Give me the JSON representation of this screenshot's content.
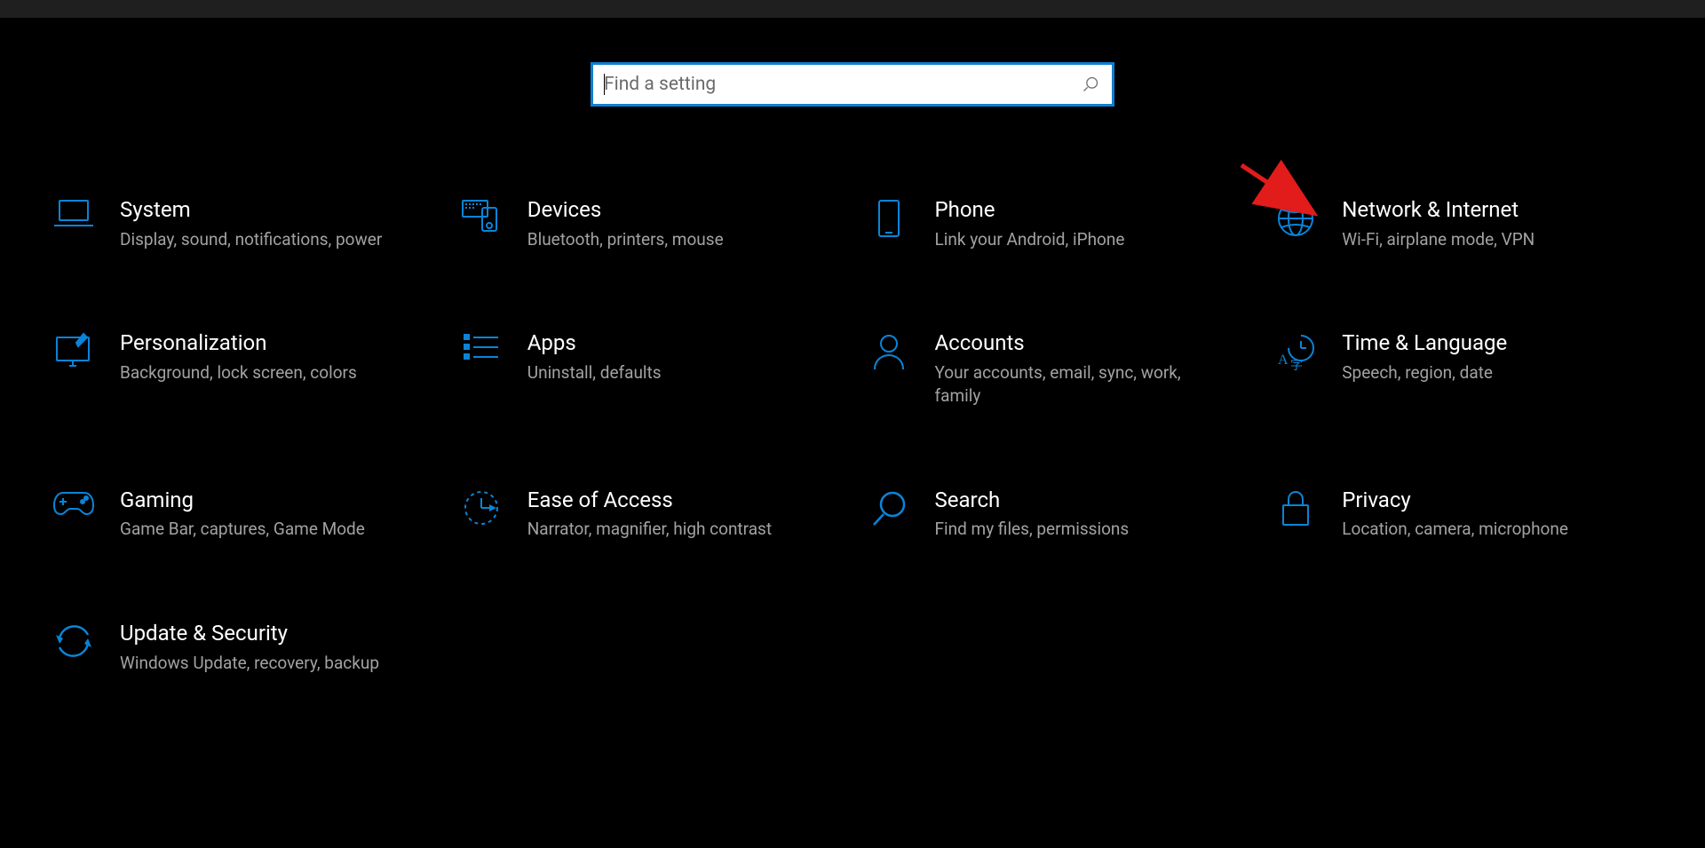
{
  "search": {
    "placeholder": "Find a setting"
  },
  "accent": "#0a84d8",
  "tiles": [
    [
      {
        "id": "system",
        "icon": "laptop",
        "title": "System",
        "desc": "Display, sound, notifications, power"
      },
      {
        "id": "devices",
        "icon": "devices",
        "title": "Devices",
        "desc": "Bluetooth, printers, mouse"
      },
      {
        "id": "phone",
        "icon": "phone",
        "title": "Phone",
        "desc": "Link your Android, iPhone"
      },
      {
        "id": "network",
        "icon": "globe",
        "title": "Network & Internet",
        "desc": "Wi-Fi, airplane mode, VPN"
      }
    ],
    [
      {
        "id": "personalization",
        "icon": "brush",
        "title": "Personalization",
        "desc": "Background, lock screen, colors"
      },
      {
        "id": "apps",
        "icon": "list",
        "title": "Apps",
        "desc": "Uninstall, defaults"
      },
      {
        "id": "accounts",
        "icon": "person",
        "title": "Accounts",
        "desc": "Your accounts, email, sync, work, family"
      },
      {
        "id": "time",
        "icon": "time",
        "title": "Time & Language",
        "desc": "Speech, region, date"
      }
    ],
    [
      {
        "id": "gaming",
        "icon": "gamepad",
        "title": "Gaming",
        "desc": "Game Bar, captures, Game Mode"
      },
      {
        "id": "ease",
        "icon": "ease",
        "title": "Ease of Access",
        "desc": "Narrator, magnifier, high contrast"
      },
      {
        "id": "search",
        "icon": "search",
        "title": "Search",
        "desc": "Find my files, permissions"
      },
      {
        "id": "privacy",
        "icon": "lock",
        "title": "Privacy",
        "desc": "Location, camera, microphone"
      }
    ],
    [
      {
        "id": "update",
        "icon": "sync",
        "title": "Update & Security",
        "desc": "Windows Update, recovery, backup"
      }
    ]
  ]
}
